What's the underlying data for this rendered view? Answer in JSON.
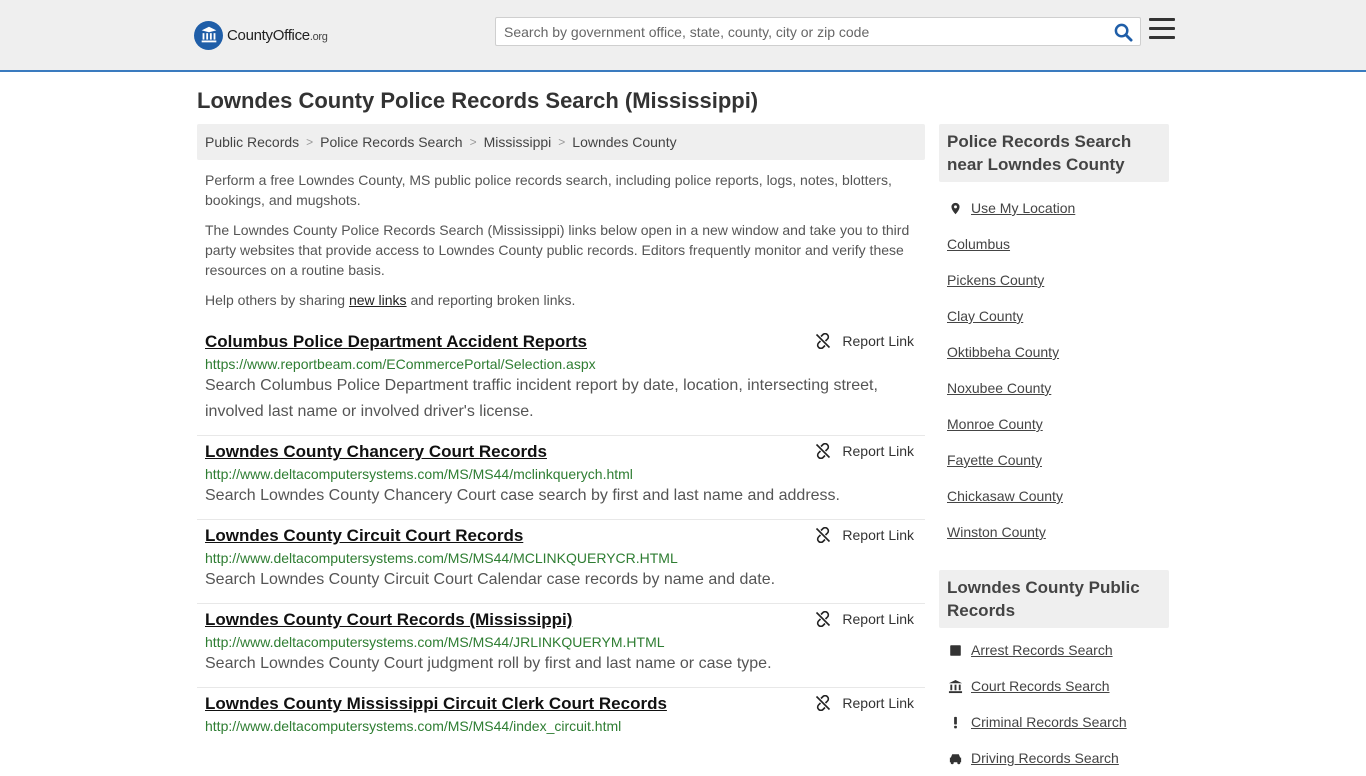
{
  "header": {
    "logo_main": "CountyOffice",
    "logo_tld": ".org",
    "search_placeholder": "Search by government office, state, county, city or zip code"
  },
  "page_title": "Lowndes County Police Records Search (Mississippi)",
  "breadcrumb": [
    "Public Records",
    "Police Records Search",
    "Mississippi",
    "Lowndes County"
  ],
  "intro": {
    "p1": "Perform a free Lowndes County, MS public police records search, including police reports, logs, notes, blotters, bookings, and mugshots.",
    "p2": "The Lowndes County Police Records Search (Mississippi) links below open in a new window and take you to third party websites that provide access to Lowndes County public records. Editors frequently monitor and verify these resources on a routine basis.",
    "p3_before": "Help others by sharing ",
    "p3_link": "new links",
    "p3_after": " and reporting broken links."
  },
  "report_label": "Report Link",
  "records": [
    {
      "title": "Columbus Police Department Accident Reports",
      "url": "https://www.reportbeam.com/ECommercePortal/Selection.aspx",
      "desc": "Search Columbus Police Department traffic incident report by date, location, intersecting street, involved last name or involved driver's license."
    },
    {
      "title": "Lowndes County Chancery Court Records",
      "url": "http://www.deltacomputersystems.com/MS/MS44/mclinkquerych.html",
      "desc": "Search Lowndes County Chancery Court case search by first and last name and address."
    },
    {
      "title": "Lowndes County Circuit Court Records",
      "url": "http://www.deltacomputersystems.com/MS/MS44/MCLINKQUERYCR.HTML",
      "desc": "Search Lowndes County Circuit Court Calendar case records by name and date."
    },
    {
      "title": "Lowndes County Court Records (Mississippi)",
      "url": "http://www.deltacomputersystems.com/MS/MS44/JRLINKQUERYM.HTML",
      "desc": "Search Lowndes County Court judgment roll by first and last name or case type."
    },
    {
      "title": "Lowndes County Mississippi Circuit Clerk Court Records",
      "url": "http://www.deltacomputersystems.com/MS/MS44/index_circuit.html",
      "desc": ""
    }
  ],
  "sidebar": {
    "near_title": "Police Records Search near Lowndes County",
    "use_location": "Use My Location",
    "near_items": [
      "Columbus",
      "Pickens County",
      "Clay County",
      "Oktibbeha County",
      "Noxubee County",
      "Monroe County",
      "Fayette County",
      "Chickasaw County",
      "Winston County"
    ],
    "public_title": "Lowndes County Public Records",
    "public_items": [
      {
        "label": "Arrest Records Search",
        "icon": "square-icon"
      },
      {
        "label": "Court Records Search",
        "icon": "courthouse-icon"
      },
      {
        "label": "Criminal Records Search",
        "icon": "exclamation-icon"
      },
      {
        "label": "Driving Records Search",
        "icon": "car-icon"
      }
    ]
  },
  "colors": {
    "accent": "#3a7bbf",
    "header_bg": "#efefef",
    "url_green": "#2e7d32"
  }
}
